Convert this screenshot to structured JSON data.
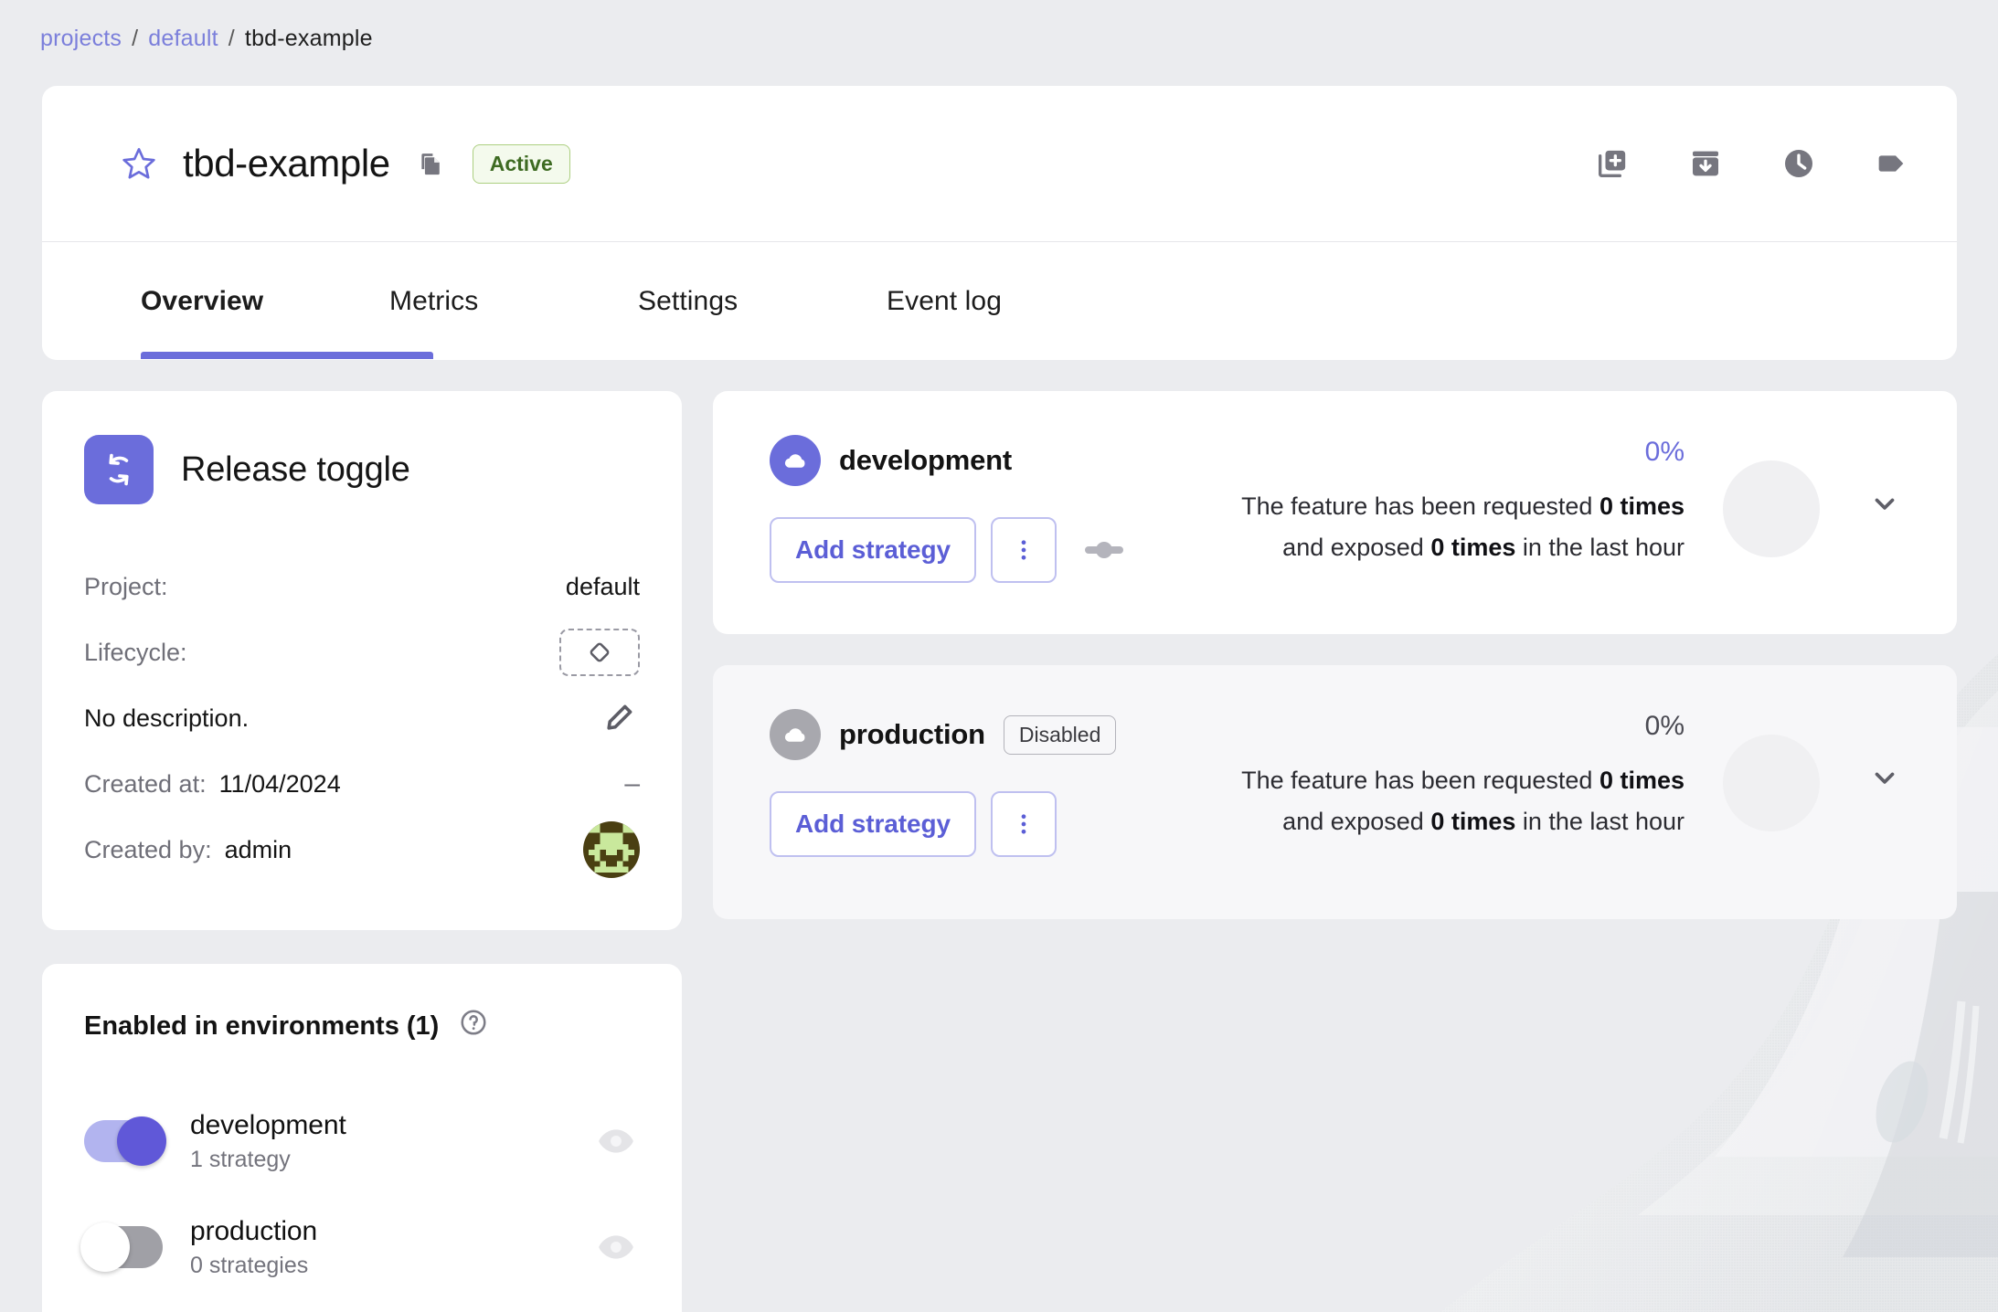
{
  "breadcrumb": {
    "items": [
      {
        "label": "projects",
        "link": true
      },
      {
        "label": "default",
        "link": true
      },
      {
        "label": "tbd-example",
        "link": false
      }
    ],
    "separator": "/"
  },
  "header": {
    "title": "tbd-example",
    "status_badge": "Active",
    "star_icon": "star-icon",
    "copy_icon": "copy-icon",
    "actions": [
      {
        "name": "add-to-collection-icon",
        "title": "Add to collection"
      },
      {
        "name": "archive-icon",
        "title": "Archive"
      },
      {
        "name": "history-icon",
        "title": "History"
      },
      {
        "name": "tag-icon",
        "title": "Tags"
      }
    ]
  },
  "tabs": [
    {
      "label": "Overview",
      "active": true
    },
    {
      "label": "Metrics",
      "active": false
    },
    {
      "label": "Settings",
      "active": false
    },
    {
      "label": "Event log",
      "active": false
    }
  ],
  "release_toggle": {
    "icon": "repeat-loop-icon",
    "title": "Release toggle",
    "project_label": "Project:",
    "project_value": "default",
    "lifecycle_label": "Lifecycle:",
    "lifecycle_icon": "diamond-icon",
    "description": "No description.",
    "edit_icon": "pencil-icon",
    "created_at_label": "Created at:",
    "created_at_value": "11/04/2024",
    "created_at_mark": "–",
    "created_by_label": "Created by:",
    "created_by_value": "admin",
    "avatar": "user-avatar"
  },
  "enabled_in_environments": {
    "heading": "Enabled in environments (1)",
    "help_icon": "help-circle-icon",
    "rows": [
      {
        "name": "development",
        "sub": "1 strategy",
        "enabled": true,
        "eye_icon": "eye-icon"
      },
      {
        "name": "production",
        "sub": "0 strategies",
        "enabled": false,
        "eye_icon": "eye-icon"
      }
    ]
  },
  "environment_panels": [
    {
      "id": "development",
      "name": "development",
      "enabled": true,
      "chip": null,
      "cloud_icon": "cloud-icon",
      "add_strategy_label": "Add strategy",
      "kebab_icon": "more-vertical-icon",
      "splitter_icon": "strategy-splitter-icon",
      "percent": "0%",
      "stat_line_1_pre": "The feature has been requested ",
      "stat_line_1_bold": "0 times",
      "stat_line_2_pre": "and exposed ",
      "stat_line_2_bold": "0 times",
      "stat_line_2_post": " in the last hour",
      "chevron_icon": "chevron-down-icon"
    },
    {
      "id": "production",
      "name": "production",
      "enabled": false,
      "chip": "Disabled",
      "cloud_icon": "cloud-icon",
      "add_strategy_label": "Add strategy",
      "kebab_icon": "more-vertical-icon",
      "splitter_icon": null,
      "percent": "0%",
      "stat_line_1_pre": "The feature has been requested ",
      "stat_line_1_bold": "0 times",
      "stat_line_2_pre": "and exposed ",
      "stat_line_2_bold": "0 times",
      "stat_line_2_post": " in the last hour",
      "chevron_icon": "chevron-down-icon"
    }
  ],
  "colors": {
    "accent": "#6b6ddb",
    "accent_deep": "#6058d8",
    "page_bg": "#ebecef",
    "card_bg": "#ffffff",
    "panel_muted_bg": "#f7f7f9",
    "badge_green_bg": "#f4faed",
    "badge_green_border": "#accf80",
    "badge_green_text": "#3e6b22",
    "muted_text": "#6f6f78",
    "icon_gray": "#76767f"
  }
}
